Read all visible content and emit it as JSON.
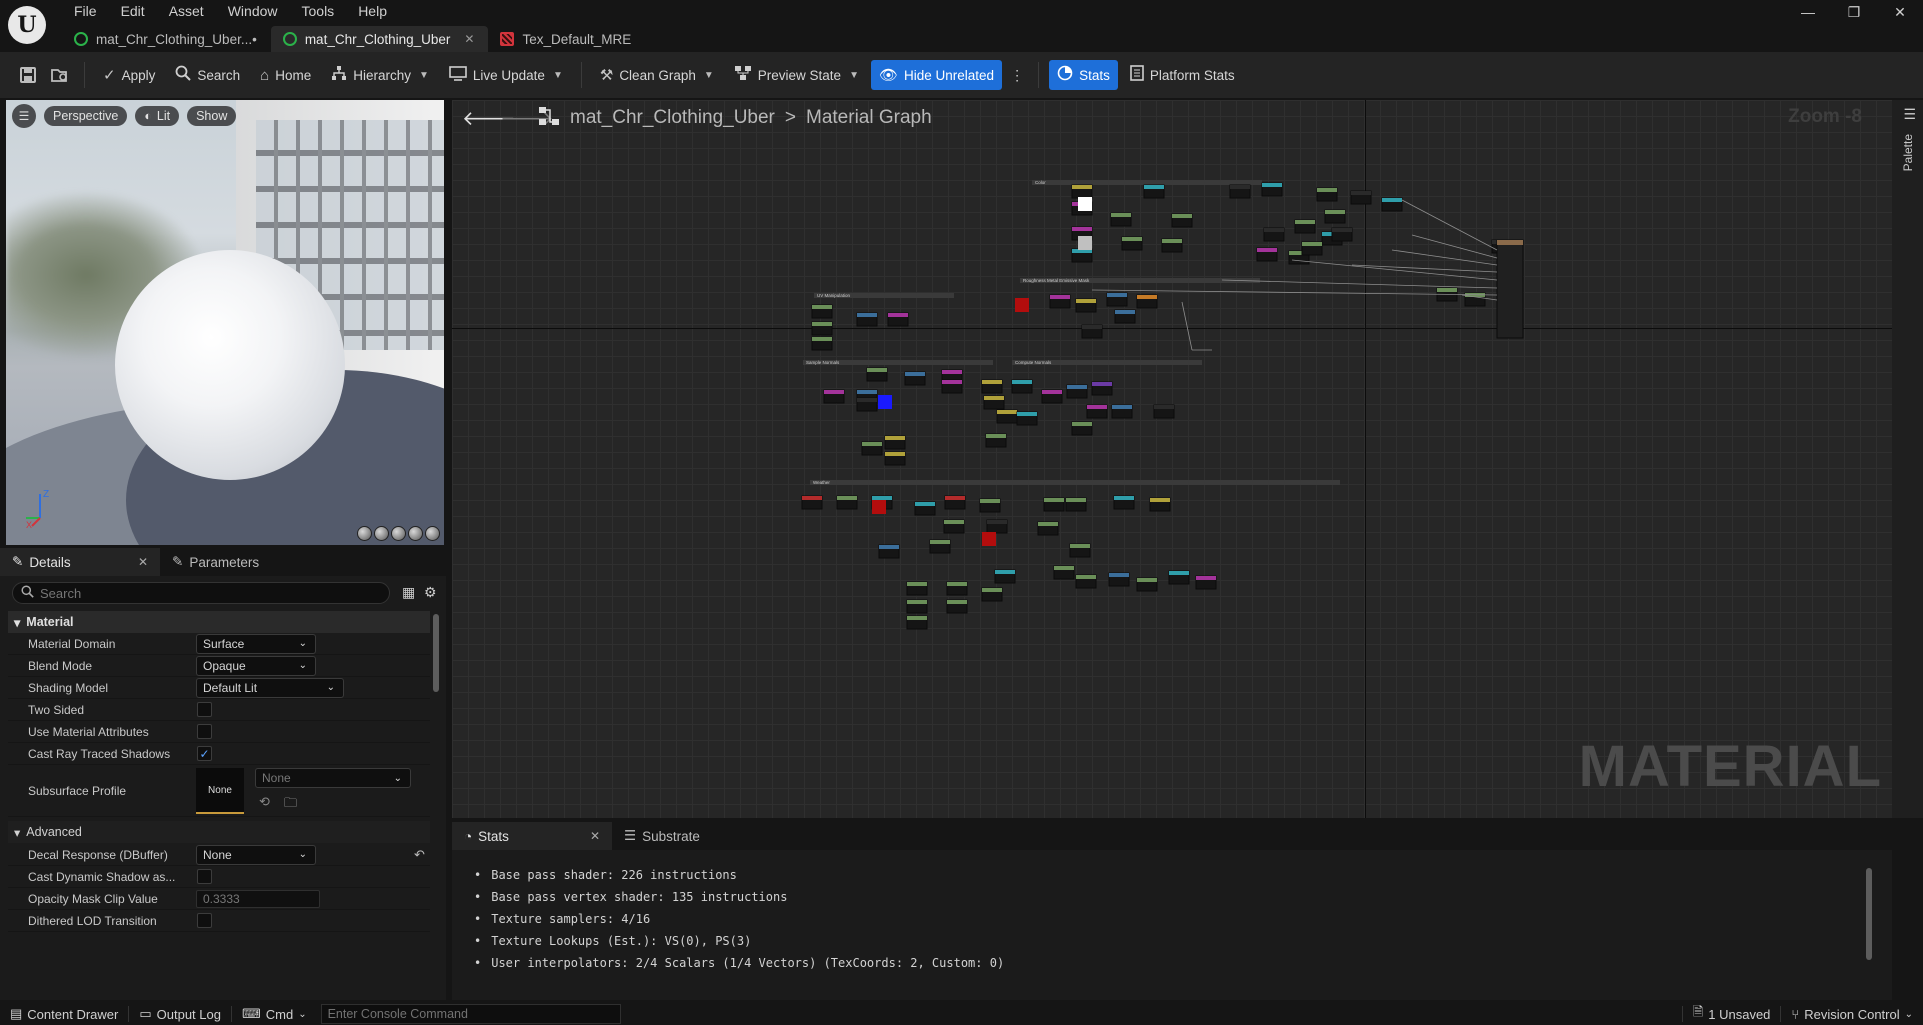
{
  "menu": [
    "File",
    "Edit",
    "Asset",
    "Window",
    "Tools",
    "Help"
  ],
  "tabs": [
    {
      "label": "mat_Chr_Clothing_Uber...•",
      "icon": "material-icon",
      "active": false
    },
    {
      "label": "mat_Chr_Clothing_Uber",
      "icon": "material-icon",
      "active": true
    },
    {
      "label": "Tex_Default_MRE",
      "icon": "texture-icon",
      "active": false
    }
  ],
  "toolbar": {
    "apply": "Apply",
    "search": "Search",
    "home": "Home",
    "hierarchy": "Hierarchy",
    "live_update": "Live Update",
    "clean_graph": "Clean Graph",
    "preview_state": "Preview State",
    "hide_unrelated": "Hide Unrelated",
    "stats": "Stats",
    "platform_stats": "Platform Stats"
  },
  "viewport": {
    "perspective": "Perspective",
    "lit": "Lit",
    "show": "Show"
  },
  "details": {
    "tab_details": "Details",
    "tab_parameters": "Parameters",
    "search_placeholder": "Search",
    "category_material": "Material",
    "category_advanced": "Advanced",
    "props": {
      "material_domain": {
        "label": "Material Domain",
        "value": "Surface"
      },
      "blend_mode": {
        "label": "Blend Mode",
        "value": "Opaque"
      },
      "shading_model": {
        "label": "Shading Model",
        "value": "Default Lit"
      },
      "two_sided": {
        "label": "Two Sided",
        "checked": false
      },
      "use_material_attributes": {
        "label": "Use Material Attributes",
        "checked": false
      },
      "cast_ray_traced_shadows": {
        "label": "Cast Ray Traced Shadows",
        "checked": true
      },
      "subsurface_profile": {
        "label": "Subsurface Profile",
        "thumb": "None",
        "value": "None"
      },
      "decal_response": {
        "label": "Decal Response (DBuffer)",
        "value": "None"
      },
      "cast_dynamic_shadow": {
        "label": "Cast Dynamic Shadow as...",
        "checked": false
      },
      "opacity_mask_clip": {
        "label": "Opacity Mask Clip Value",
        "value": "0.3333"
      },
      "dithered_lod": {
        "label": "Dithered LOD Transition",
        "checked": false
      }
    }
  },
  "graph": {
    "asset": "mat_Chr_Clothing_Uber",
    "location": "Material Graph",
    "zoom": "Zoom -8",
    "watermark": "MATERIAL",
    "palette": "Palette",
    "comments": [
      "Color",
      "Roughness Metal Emissive Mask",
      "UV Manipulation",
      "Sample Normals",
      "Compute Normals",
      "Weather"
    ]
  },
  "stats_panel": {
    "tab_stats": "Stats",
    "tab_substrate": "Substrate",
    "lines": [
      "Base pass shader: 226 instructions",
      "Base pass vertex shader: 135 instructions",
      "Texture samplers: 4/16",
      "Texture Lookups (Est.): VS(0), PS(3)",
      "User interpolators: 2/4 Scalars (1/4 Vectors) (TexCoords: 2, Custom: 0)"
    ]
  },
  "statusbar": {
    "content_drawer": "Content Drawer",
    "output_log": "Output Log",
    "cmd": "Cmd",
    "console_placeholder": "Enter Console Command",
    "unsaved": "1 Unsaved",
    "revision_control": "Revision Control"
  }
}
